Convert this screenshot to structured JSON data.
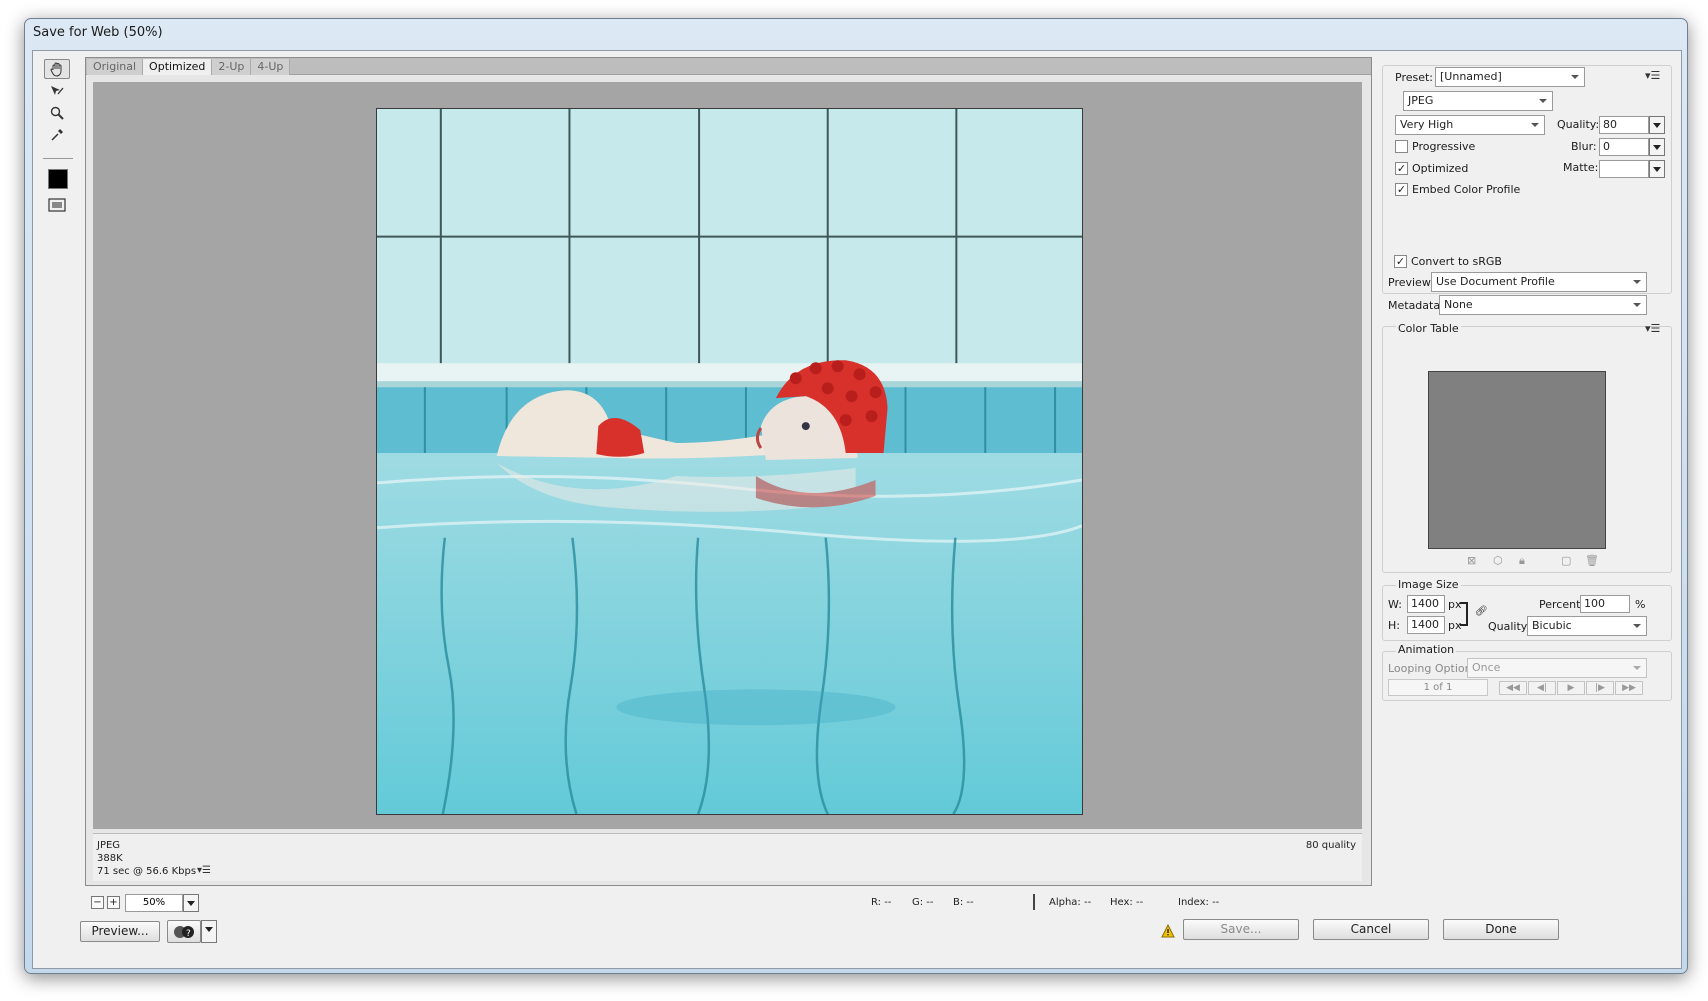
{
  "window": {
    "title": "Save for Web (50%)"
  },
  "tabs": [
    "Original",
    "Optimized",
    "2-Up",
    "4-Up"
  ],
  "active_tab": "Optimized",
  "image_info": {
    "format": "JPEG",
    "size": "388K",
    "download": "71 sec @ 56.6 Kbps",
    "quality_note": "80 quality"
  },
  "zoom": {
    "value": "50%"
  },
  "readouts": {
    "r": "R: --",
    "g": "G: --",
    "b": "B: --",
    "alpha": "Alpha: --",
    "hex": "Hex: --",
    "index": "Index: --"
  },
  "buttons": {
    "preview": "Preview...",
    "save": "Save...",
    "cancel": "Cancel",
    "done": "Done"
  },
  "settings": {
    "preset_label": "Preset:",
    "preset_value": "[Unnamed]",
    "format_value": "JPEG",
    "quality_level": "Very High",
    "quality_label": "Quality:",
    "quality_value": "80",
    "progressive_label": "Progressive",
    "progressive_checked": false,
    "blur_label": "Blur:",
    "blur_value": "0",
    "optimized_label": "Optimized",
    "optimized_checked": true,
    "matte_label": "Matte:",
    "matte_value": "",
    "embed_label": "Embed Color Profile",
    "embed_checked": true,
    "srgb_label": "Convert to sRGB",
    "srgb_checked": true,
    "preview_label": "Preview:",
    "preview_value": "Use Document Profile",
    "metadata_label": "Metadata:",
    "metadata_value": "None"
  },
  "color_table": {
    "title": "Color Table"
  },
  "image_size": {
    "title": "Image Size",
    "w_label": "W:",
    "w_value": "1400",
    "h_label": "H:",
    "h_value": "1400",
    "unit": "px",
    "percent_label": "Percent:",
    "percent_value": "100",
    "percent_unit": "%",
    "quality_label": "Quality:",
    "quality_value": "Bicubic"
  },
  "animation": {
    "title": "Animation",
    "looping_label": "Looping Options:",
    "looping_value": "Once",
    "frame_counter": "1 of 1"
  },
  "colors": {
    "accent": "#5fc6d4",
    "cap_red": "#d8312b",
    "background_gray": "#a5a5a5"
  }
}
